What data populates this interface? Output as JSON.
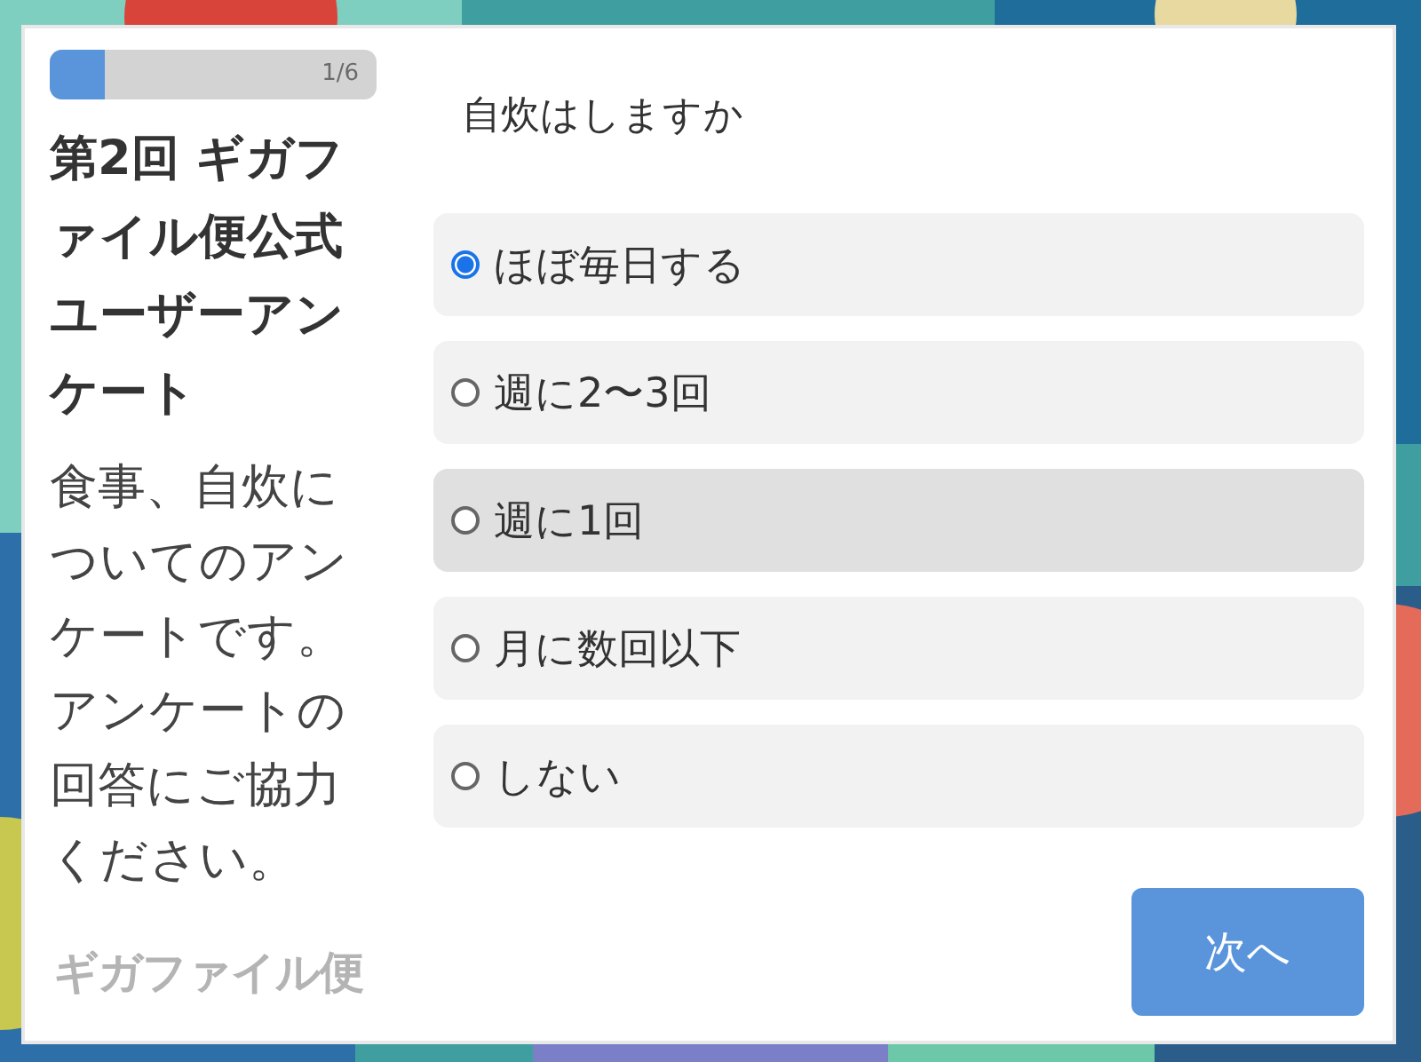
{
  "progress": {
    "level": 0.17,
    "label": "1/6"
  },
  "survey": {
    "title": "第2回 ギガファイル便公式ユーザーアンケート",
    "description": "食事、自炊についてのアンケートです。アンケートの回答にご協力ください。"
  },
  "logo": {
    "text": "ギガファイル便"
  },
  "question": "自炊はしますか",
  "options": [
    {
      "label": "ほぼ毎日する",
      "selected": true,
      "hovered": false
    },
    {
      "label": "週に2〜3回",
      "selected": false,
      "hovered": false
    },
    {
      "label": "週に1回",
      "selected": false,
      "hovered": true
    },
    {
      "label": "月に数回以下",
      "selected": false,
      "hovered": false
    },
    {
      "label": "しない",
      "selected": false,
      "hovered": false
    }
  ],
  "next_button": "次へ"
}
